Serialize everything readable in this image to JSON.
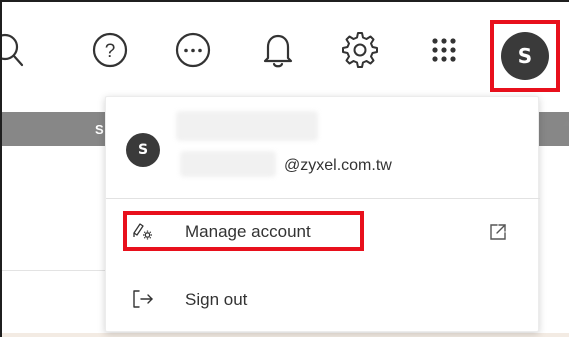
{
  "toolbar": {
    "icons": [
      "search-icon",
      "help-icon",
      "more-icon",
      "bell-icon",
      "gear-icon",
      "apps-icon"
    ],
    "help_glyph": "?",
    "more_glyph": "···"
  },
  "user": {
    "initial": "S",
    "avatar_color": "#3a3a3a",
    "email_domain": "@zyxel.com.tw"
  },
  "background": {
    "band_text": "S"
  },
  "menu": {
    "manage_account": "Manage account",
    "sign_out": "Sign out"
  },
  "colors": {
    "highlight": "#e8101c",
    "band": "#878787"
  }
}
